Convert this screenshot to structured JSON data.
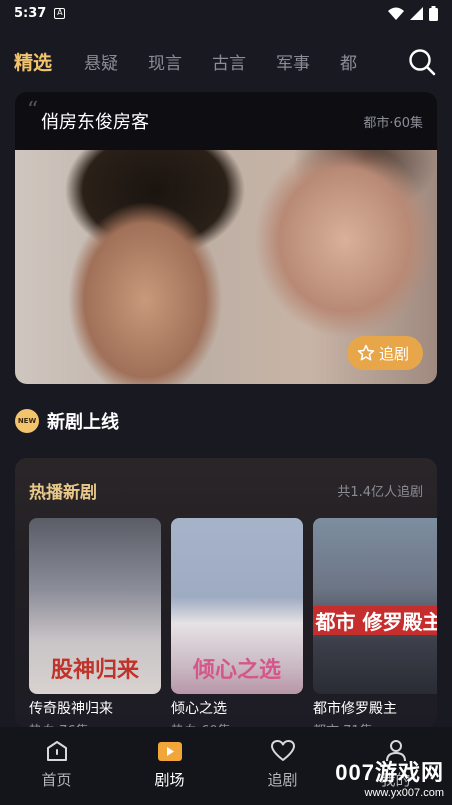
{
  "status_bar": {
    "time": "5:37",
    "notif_glyph": "A"
  },
  "tabs": [
    {
      "label": "精选",
      "active": true
    },
    {
      "label": "悬疑"
    },
    {
      "label": "现言"
    },
    {
      "label": "古言"
    },
    {
      "label": "军事"
    },
    {
      "label": "都"
    }
  ],
  "feature": {
    "quote_glyph": "“",
    "title": "俏房东俊房客",
    "meta": "都市·60集",
    "follow_label": "追剧"
  },
  "new_section": {
    "badge": "NEW",
    "title": "新剧上线"
  },
  "hot": {
    "title": "热播新剧",
    "count": "共1.4亿人追剧",
    "dramas": [
      {
        "name": "传奇股神归来",
        "meta": "热血·76集",
        "poster_text": "股神归来"
      },
      {
        "name": "倾心之选",
        "meta": "热血·60集",
        "poster_text": "倾心之选"
      },
      {
        "name": "都市修罗殿主",
        "meta": "都市·71集",
        "poster_text": "都市 修罗殿主"
      }
    ]
  },
  "bottom_nav": [
    {
      "label": "首页",
      "icon": "home-icon"
    },
    {
      "label": "剧场",
      "icon": "theater-icon",
      "active": true
    },
    {
      "label": "追剧",
      "icon": "heart-icon"
    },
    {
      "label": "我的",
      "icon": "profile-icon"
    }
  ],
  "watermark": {
    "big": "007游戏网",
    "small": "www.yx007.com"
  },
  "colors": {
    "accent": "#f2c46d",
    "follow": "#e8a64a",
    "bg": "#191922"
  }
}
